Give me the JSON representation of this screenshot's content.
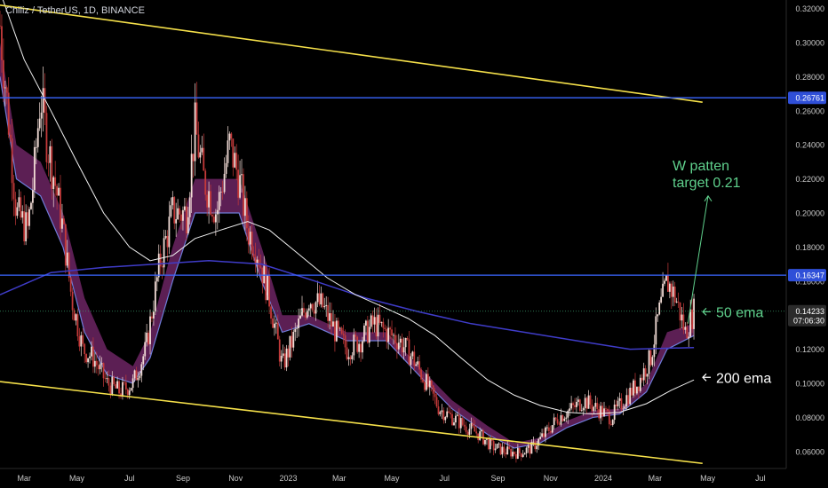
{
  "header": {
    "symbol_line": "Chiliz / TetherUS, 1D, BINANCE"
  },
  "colors": {
    "background": "#000000",
    "up_candle": "#f2dcd6",
    "down_candle": "#c43a3a",
    "ema_band": "#7b2a70",
    "ema_line": "#6e7cd8",
    "ema200": "#f0f0f0",
    "long_ma": "#3f3cc8",
    "channel": "#f5e04a",
    "hline": "#3a66ff",
    "annotation_green": "#5fd08c",
    "annotation_white": "#ffffff",
    "price_tag": "#2f4fd8",
    "last_price_tag": "#2b2b2b"
  },
  "chart_data": {
    "type": "candlestick",
    "ylim": [
      0.05,
      0.325
    ],
    "y_ticks": [
      0.06,
      0.08,
      0.1,
      0.12,
      0.14,
      0.16,
      0.18,
      0.2,
      0.22,
      0.24,
      0.26,
      0.28,
      0.3,
      0.32
    ],
    "y_tick_labels": [
      "0.06000",
      "0.08000",
      "0.10000",
      "0.12000",
      "0.14000",
      "0.16000",
      "0.18000",
      "0.20000",
      "0.22000",
      "0.24000",
      "0.26000",
      "0.28000",
      "0.30000",
      "0.32000"
    ],
    "x_range": [
      "2022-02-01",
      "2024-07-31"
    ],
    "x_ticks": [
      {
        "date": "2022-03-01",
        "label": "Mar"
      },
      {
        "date": "2022-05-01",
        "label": "May"
      },
      {
        "date": "2022-07-01",
        "label": "Jul"
      },
      {
        "date": "2022-09-01",
        "label": "Sep"
      },
      {
        "date": "2022-11-01",
        "label": "Nov"
      },
      {
        "date": "2023-01-01",
        "label": "2023"
      },
      {
        "date": "2023-03-01",
        "label": "Mar"
      },
      {
        "date": "2023-05-01",
        "label": "May"
      },
      {
        "date": "2023-07-01",
        "label": "Jul"
      },
      {
        "date": "2023-09-01",
        "label": "Sep"
      },
      {
        "date": "2023-11-01",
        "label": "Nov"
      },
      {
        "date": "2024-01-01",
        "label": "2024"
      },
      {
        "date": "2024-03-01",
        "label": "Mar"
      },
      {
        "date": "2024-05-01",
        "label": "May"
      },
      {
        "date": "2024-07-01",
        "label": "Jul"
      }
    ],
    "price_path": [
      [
        "2022-02-01",
        0.31
      ],
      [
        "2022-02-10",
        0.26
      ],
      [
        "2022-02-20",
        0.2
      ],
      [
        "2022-03-05",
        0.19
      ],
      [
        "2022-03-12",
        0.22
      ],
      [
        "2022-03-20",
        0.27
      ],
      [
        "2022-03-28",
        0.24
      ],
      [
        "2022-04-05",
        0.22
      ],
      [
        "2022-04-15",
        0.19
      ],
      [
        "2022-04-25",
        0.15
      ],
      [
        "2022-05-08",
        0.12
      ],
      [
        "2022-05-20",
        0.115
      ],
      [
        "2022-06-05",
        0.1
      ],
      [
        "2022-06-20",
        0.095
      ],
      [
        "2022-07-05",
        0.1
      ],
      [
        "2022-07-20",
        0.12
      ],
      [
        "2022-08-05",
        0.17
      ],
      [
        "2022-08-20",
        0.2
      ],
      [
        "2022-09-05",
        0.2
      ],
      [
        "2022-09-15",
        0.25
      ],
      [
        "2022-09-25",
        0.22
      ],
      [
        "2022-10-10",
        0.2
      ],
      [
        "2022-10-25",
        0.24
      ],
      [
        "2022-11-05",
        0.22
      ],
      [
        "2022-11-15",
        0.19
      ],
      [
        "2022-11-25",
        0.18
      ],
      [
        "2022-12-10",
        0.15
      ],
      [
        "2022-12-25",
        0.11
      ],
      [
        "2023-01-10",
        0.13
      ],
      [
        "2023-01-25",
        0.15
      ],
      [
        "2023-02-10",
        0.145
      ],
      [
        "2023-02-25",
        0.13
      ],
      [
        "2023-03-10",
        0.12
      ],
      [
        "2023-03-25",
        0.125
      ],
      [
        "2023-04-10",
        0.135
      ],
      [
        "2023-04-25",
        0.13
      ],
      [
        "2023-05-10",
        0.125
      ],
      [
        "2023-05-25",
        0.115
      ],
      [
        "2023-06-10",
        0.1
      ],
      [
        "2023-06-25",
        0.085
      ],
      [
        "2023-07-10",
        0.08
      ],
      [
        "2023-07-25",
        0.075
      ],
      [
        "2023-08-10",
        0.07
      ],
      [
        "2023-08-25",
        0.063
      ],
      [
        "2023-09-10",
        0.06
      ],
      [
        "2023-09-25",
        0.059
      ],
      [
        "2023-10-10",
        0.062
      ],
      [
        "2023-10-25",
        0.07
      ],
      [
        "2023-11-10",
        0.08
      ],
      [
        "2023-11-25",
        0.085
      ],
      [
        "2023-12-10",
        0.09
      ],
      [
        "2023-12-25",
        0.085
      ],
      [
        "2024-01-10",
        0.08
      ],
      [
        "2024-01-25",
        0.09
      ],
      [
        "2024-02-10",
        0.1
      ],
      [
        "2024-02-25",
        0.115
      ],
      [
        "2024-03-05",
        0.14
      ],
      [
        "2024-03-15",
        0.16
      ],
      [
        "2024-03-25",
        0.15
      ],
      [
        "2024-04-05",
        0.13
      ],
      [
        "2024-04-15",
        0.14233
      ]
    ],
    "ema_band_path": [
      [
        "2022-02-01",
        0.3,
        0.28
      ],
      [
        "2022-02-20",
        0.24,
        0.22
      ],
      [
        "2022-03-20",
        0.23,
        0.21
      ],
      [
        "2022-04-15",
        0.2,
        0.18
      ],
      [
        "2022-05-10",
        0.15,
        0.13
      ],
      [
        "2022-06-05",
        0.12,
        0.105
      ],
      [
        "2022-07-05",
        0.11,
        0.1
      ],
      [
        "2022-07-25",
        0.13,
        0.115
      ],
      [
        "2022-08-20",
        0.18,
        0.16
      ],
      [
        "2022-09-15",
        0.22,
        0.2
      ],
      [
        "2022-10-15",
        0.22,
        0.2
      ],
      [
        "2022-11-05",
        0.22,
        0.2
      ],
      [
        "2022-12-01",
        0.18,
        0.16
      ],
      [
        "2022-12-25",
        0.14,
        0.13
      ],
      [
        "2023-01-25",
        0.14,
        0.135
      ],
      [
        "2023-03-10",
        0.13,
        0.125
      ],
      [
        "2023-04-25",
        0.13,
        0.125
      ],
      [
        "2023-06-01",
        0.11,
        0.105
      ],
      [
        "2023-07-10",
        0.09,
        0.085
      ],
      [
        "2023-08-20",
        0.075,
        0.07
      ],
      [
        "2023-09-20",
        0.065,
        0.062
      ],
      [
        "2023-10-20",
        0.068,
        0.065
      ],
      [
        "2023-11-20",
        0.078,
        0.074
      ],
      [
        "2023-12-20",
        0.084,
        0.08
      ],
      [
        "2024-01-20",
        0.085,
        0.082
      ],
      [
        "2024-02-20",
        0.1,
        0.095
      ],
      [
        "2024-03-15",
        0.13,
        0.12
      ],
      [
        "2024-04-15",
        0.135,
        0.128
      ]
    ],
    "ema200_path": [
      [
        "2022-02-01",
        0.33
      ],
      [
        "2022-03-01",
        0.29
      ],
      [
        "2022-04-01",
        0.26
      ],
      [
        "2022-05-01",
        0.23
      ],
      [
        "2022-06-01",
        0.2
      ],
      [
        "2022-07-01",
        0.18
      ],
      [
        "2022-07-25",
        0.172
      ],
      [
        "2022-08-20",
        0.175
      ],
      [
        "2022-09-15",
        0.185
      ],
      [
        "2022-10-15",
        0.19
      ],
      [
        "2022-11-15",
        0.195
      ],
      [
        "2022-12-10",
        0.19
      ],
      [
        "2023-01-15",
        0.175
      ],
      [
        "2023-02-15",
        0.162
      ],
      [
        "2023-03-20",
        0.152
      ],
      [
        "2023-04-20",
        0.145
      ],
      [
        "2023-05-20",
        0.138
      ],
      [
        "2023-06-20",
        0.128
      ],
      [
        "2023-07-20",
        0.115
      ],
      [
        "2023-08-20",
        0.102
      ],
      [
        "2023-09-20",
        0.093
      ],
      [
        "2023-10-20",
        0.087
      ],
      [
        "2023-11-20",
        0.083
      ],
      [
        "2023-12-20",
        0.082
      ],
      [
        "2024-01-20",
        0.083
      ],
      [
        "2024-02-20",
        0.088
      ],
      [
        "2024-03-20",
        0.096
      ],
      [
        "2024-04-15",
        0.102
      ]
    ],
    "long_ma_path": [
      [
        "2022-02-01",
        0.152
      ],
      [
        "2022-04-01",
        0.165
      ],
      [
        "2022-06-01",
        0.168
      ],
      [
        "2022-08-01",
        0.17
      ],
      [
        "2022-10-01",
        0.172
      ],
      [
        "2022-12-01",
        0.17
      ],
      [
        "2023-02-01",
        0.16
      ],
      [
        "2023-04-01",
        0.15
      ],
      [
        "2023-06-01",
        0.142
      ],
      [
        "2023-08-01",
        0.135
      ],
      [
        "2023-10-01",
        0.13
      ],
      [
        "2023-12-01",
        0.125
      ],
      [
        "2024-02-01",
        0.12
      ],
      [
        "2024-04-15",
        0.121
      ]
    ],
    "channel_lines": [
      {
        "name": "upper",
        "from": [
          "2022-02-01",
          0.322
        ],
        "to": [
          "2024-04-25",
          0.265
        ]
      },
      {
        "name": "lower",
        "from": [
          "2022-02-01",
          0.101
        ],
        "to": [
          "2024-04-25",
          0.053
        ]
      }
    ],
    "horizontal_levels": [
      {
        "value": 0.26761,
        "label": "0.26761"
      },
      {
        "value": 0.16347,
        "label": "0.16347"
      }
    ],
    "last_price": {
      "value": 0.14233,
      "label": "0.14233",
      "countdown": "07:06:30"
    },
    "annotations": {
      "w_pattern_line1": "W patten",
      "w_pattern_line2": "target 0.21",
      "ema50_label": "50 ema",
      "ema200_label": "200 ema"
    }
  }
}
